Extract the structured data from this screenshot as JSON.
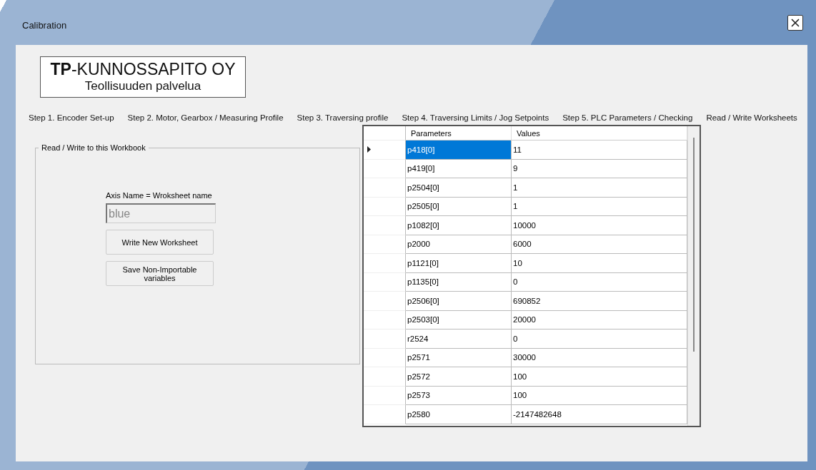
{
  "window": {
    "title": "Calibration"
  },
  "logo": {
    "name": "**TP**-KUNNOSSAPITO OY",
    "tagline": "Teollisuuden palvelua"
  },
  "tabs": [
    {
      "label": "Step 1. Encoder Set-up"
    },
    {
      "label": "Step 2. Motor, Gearbox / Measuring Profile"
    },
    {
      "label": "Step 3. Traversing profile"
    },
    {
      "label": "Step 4. Traversing Limits / Jog Setpoints"
    },
    {
      "label": "Step 5. PLC Parameters / Checking"
    },
    {
      "label": "Read / Write Worksheets"
    }
  ],
  "group": {
    "title": "Read / Write to this Workbook",
    "field_label": "Axis Name = Wroksheet name",
    "field_placeholder": "blue",
    "buttons": [
      "Write New Worksheet",
      "Save Non-Importable variables"
    ]
  },
  "table": {
    "columns": [
      "Parameters",
      "Values"
    ],
    "rows": [
      {
        "cells": [
          "p418[0]",
          "11"
        ],
        "selected": true
      },
      {
        "cells": [
          "p419[0]",
          "9"
        ],
        "selected": false
      },
      {
        "cells": [
          "p2504[0]",
          "1"
        ],
        "selected": false
      },
      {
        "cells": [
          "p2505[0]",
          "1"
        ],
        "selected": false
      },
      {
        "cells": [
          "p1082[0]",
          "10000"
        ],
        "selected": false
      },
      {
        "cells": [
          "p2000",
          "6000"
        ],
        "selected": false
      },
      {
        "cells": [
          "p1121[0]",
          "10"
        ],
        "selected": false
      },
      {
        "cells": [
          "p1135[0]",
          "0"
        ],
        "selected": false
      },
      {
        "cells": [
          "p2506[0]",
          "690852"
        ],
        "selected": false
      },
      {
        "cells": [
          "p2503[0]",
          "20000"
        ],
        "selected": false
      },
      {
        "cells": [
          "r2524",
          "0"
        ],
        "selected": false
      },
      {
        "cells": [
          "p2571",
          "30000"
        ],
        "selected": false
      },
      {
        "cells": [
          "p2572",
          "100"
        ],
        "selected": false
      },
      {
        "cells": [
          "p2573",
          "100"
        ],
        "selected": false
      },
      {
        "cells": [
          "p2580",
          "-2147482648"
        ],
        "selected": false
      }
    ]
  }
}
